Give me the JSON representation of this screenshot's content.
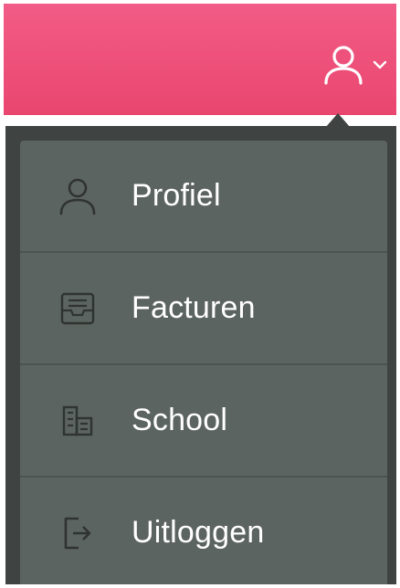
{
  "colors": {
    "header": "#ef5480",
    "menu_background": "#5c6461",
    "menu_divider": "#4c5350",
    "text": "#ffffff",
    "icon": "#2f3331"
  },
  "header": {
    "user_icon": "user-icon",
    "chevron_icon": "chevron-down-icon"
  },
  "menu": {
    "items": [
      {
        "label": "Profiel",
        "icon": "user-icon"
      },
      {
        "label": "Facturen",
        "icon": "inbox-icon"
      },
      {
        "label": "School",
        "icon": "building-icon"
      },
      {
        "label": "Uitloggen",
        "icon": "logout-icon"
      }
    ]
  }
}
